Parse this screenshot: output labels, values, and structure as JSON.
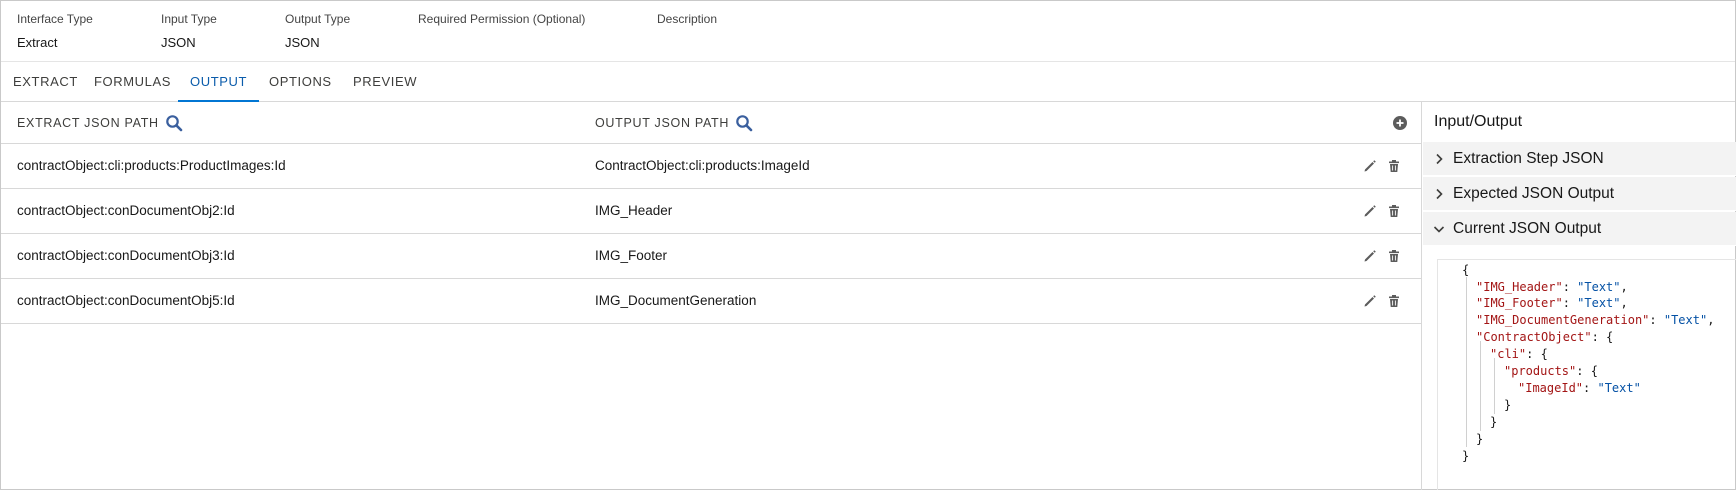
{
  "info": {
    "interface_type": {
      "label": "Interface Type",
      "value": "Extract"
    },
    "input_type": {
      "label": "Input Type",
      "value": "JSON"
    },
    "output_type": {
      "label": "Output Type",
      "value": "JSON"
    },
    "required_permission": {
      "label": "Required Permission (Optional)",
      "value": ""
    },
    "description": {
      "label": "Description",
      "value": ""
    }
  },
  "tabs": [
    {
      "label": "EXTRACT",
      "active": false
    },
    {
      "label": "FORMULAS",
      "active": false
    },
    {
      "label": "OUTPUT",
      "active": true
    },
    {
      "label": "OPTIONS",
      "active": false
    },
    {
      "label": "PREVIEW",
      "active": false
    }
  ],
  "table": {
    "columns": [
      "EXTRACT JSON PATH",
      "OUTPUT JSON PATH"
    ],
    "rows": [
      {
        "extract": "contractObject:cli:products:ProductImages:Id",
        "output": "ContractObject:cli:products:ImageId"
      },
      {
        "extract": "contractObject:conDocumentObj2:Id",
        "output": "IMG_Header"
      },
      {
        "extract": "contractObject:conDocumentObj3:Id",
        "output": "IMG_Footer"
      },
      {
        "extract": "contractObject:conDocumentObj5:Id",
        "output": "IMG_DocumentGeneration"
      }
    ]
  },
  "panel": {
    "title": "Input/Output",
    "sections": [
      {
        "label": "Extraction Step JSON",
        "expanded": false
      },
      {
        "label": "Expected JSON Output",
        "expanded": false
      },
      {
        "label": "Current JSON Output",
        "expanded": true
      }
    ],
    "json": {
      "open_brace": "{",
      "close_brace": "}",
      "img_header_key": "\"IMG_Header\"",
      "img_header_val": "\"Text\"",
      "img_footer_key": "\"IMG_Footer\"",
      "img_footer_val": "\"Text\"",
      "img_docgen_key": "\"IMG_DocumentGeneration\"",
      "img_docgen_val": "\"Text\"",
      "contract_key": "\"ContractObject\"",
      "cli_key": "\"cli\"",
      "products_key": "\"products\"",
      "imageid_key": "\"ImageId\"",
      "imageid_val": "\"Text\""
    }
  },
  "icons": {
    "search": "search-icon",
    "add": "add-icon",
    "edit": "pencil-icon",
    "delete": "trash-icon",
    "collapsed": "chevron-right-icon",
    "expanded": "chevron-down-icon"
  },
  "colors": {
    "accent": "#0176d3",
    "active_tab_text": "#0b5cab",
    "json_key": "#a31515",
    "json_string": "#0451a5",
    "accordion_bg": "#f3f3f3"
  }
}
